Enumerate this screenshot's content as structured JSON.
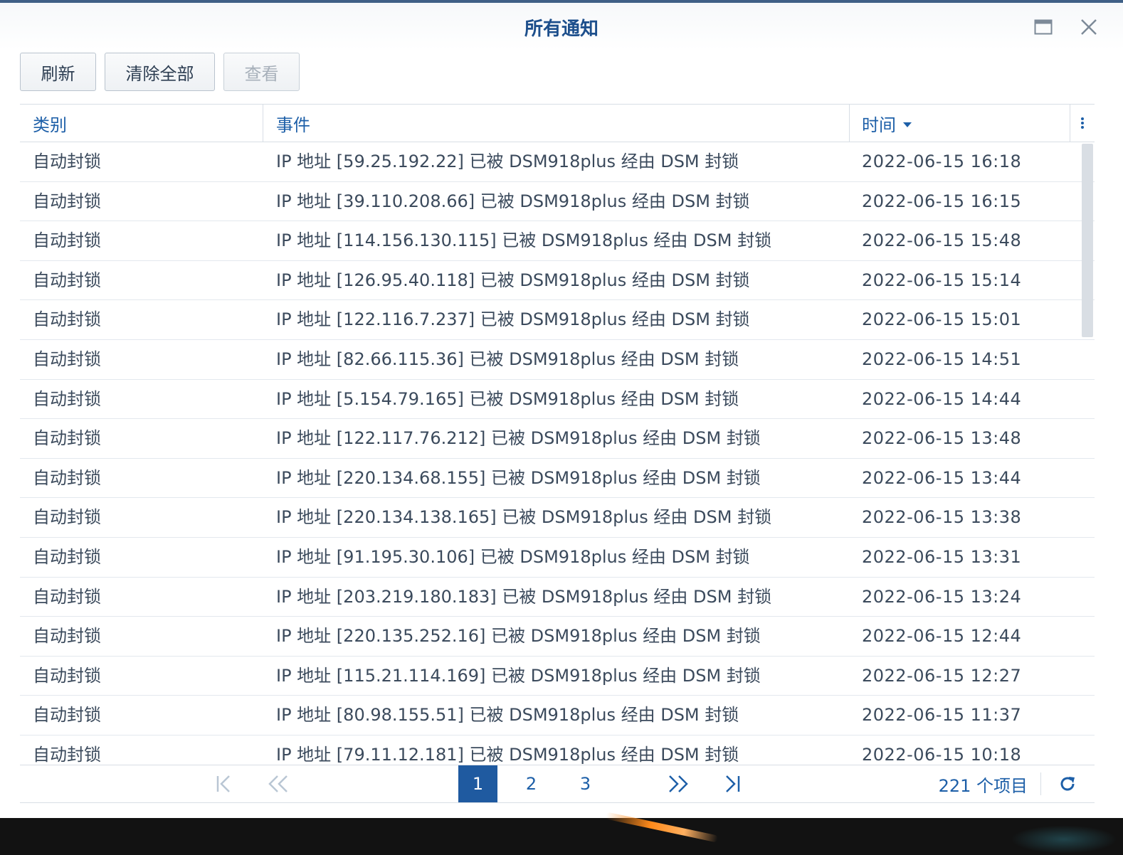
{
  "window": {
    "title": "所有通知",
    "maximize_icon": "maximize-icon",
    "close_icon": "close-icon"
  },
  "toolbar": {
    "refresh_label": "刷新",
    "clear_all_label": "清除全部",
    "view_label": "查看"
  },
  "table": {
    "columns": {
      "category": "类别",
      "event": "事件",
      "time": "时间"
    },
    "sort": {
      "column": "time",
      "direction": "descending"
    },
    "rows": [
      {
        "category": "自动封锁",
        "event": "IP 地址 [59.25.192.22] 已被 DSM918plus 经由 DSM 封锁",
        "time": "2022-06-15 16:18"
      },
      {
        "category": "自动封锁",
        "event": "IP 地址 [39.110.208.66] 已被 DSM918plus 经由 DSM 封锁",
        "time": "2022-06-15 16:15"
      },
      {
        "category": "自动封锁",
        "event": "IP 地址 [114.156.130.115] 已被 DSM918plus 经由 DSM 封锁",
        "time": "2022-06-15 15:48"
      },
      {
        "category": "自动封锁",
        "event": "IP 地址 [126.95.40.118] 已被 DSM918plus 经由 DSM 封锁",
        "time": "2022-06-15 15:14"
      },
      {
        "category": "自动封锁",
        "event": "IP 地址 [122.116.7.237] 已被 DSM918plus 经由 DSM 封锁",
        "time": "2022-06-15 15:01"
      },
      {
        "category": "自动封锁",
        "event": "IP 地址 [82.66.115.36] 已被 DSM918plus 经由 DSM 封锁",
        "time": "2022-06-15 14:51"
      },
      {
        "category": "自动封锁",
        "event": "IP 地址 [5.154.79.165] 已被 DSM918plus 经由 DSM 封锁",
        "time": "2022-06-15 14:44"
      },
      {
        "category": "自动封锁",
        "event": "IP 地址 [122.117.76.212] 已被 DSM918plus 经由 DSM 封锁",
        "time": "2022-06-15 13:48"
      },
      {
        "category": "自动封锁",
        "event": "IP 地址 [220.134.68.155] 已被 DSM918plus 经由 DSM 封锁",
        "time": "2022-06-15 13:44"
      },
      {
        "category": "自动封锁",
        "event": "IP 地址 [220.134.138.165] 已被 DSM918plus 经由 DSM 封锁",
        "time": "2022-06-15 13:38"
      },
      {
        "category": "自动封锁",
        "event": "IP 地址 [91.195.30.106] 已被 DSM918plus 经由 DSM 封锁",
        "time": "2022-06-15 13:31"
      },
      {
        "category": "自动封锁",
        "event": "IP 地址 [203.219.180.183] 已被 DSM918plus 经由 DSM 封锁",
        "time": "2022-06-15 13:24"
      },
      {
        "category": "自动封锁",
        "event": "IP 地址 [220.135.252.16] 已被 DSM918plus 经由 DSM 封锁",
        "time": "2022-06-15 12:44"
      },
      {
        "category": "自动封锁",
        "event": "IP 地址 [115.21.114.169] 已被 DSM918plus 经由 DSM 封锁",
        "time": "2022-06-15 12:27"
      },
      {
        "category": "自动封锁",
        "event": "IP 地址 [80.98.155.51] 已被 DSM918plus 经由 DSM 封锁",
        "time": "2022-06-15 11:37"
      },
      {
        "category": "自动封锁",
        "event": "IP 地址 [79.11.12.181] 已被 DSM918plus 经由 DSM 封锁",
        "time": "2022-06-15 10:18"
      }
    ]
  },
  "pager": {
    "pages": [
      "1",
      "2",
      "3"
    ],
    "current_page": "1",
    "total_label": "221 个项目"
  },
  "colors": {
    "accent": "#1f5aa0",
    "header_text": "#1d5fa8",
    "title_text": "#1d4f8c",
    "row_text": "#3b4a5c"
  }
}
